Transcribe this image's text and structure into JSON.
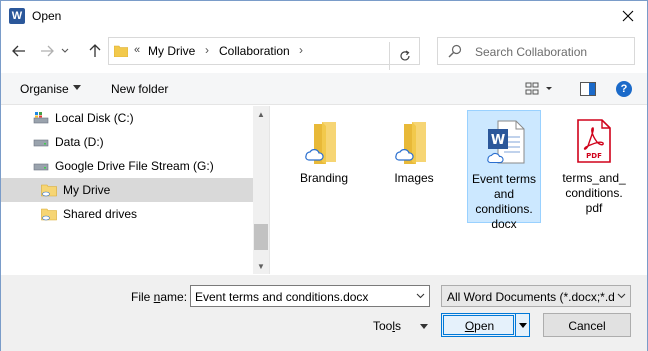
{
  "window": {
    "title": "Open",
    "app_icon_letter": "W",
    "close_glyph": "✕"
  },
  "navbar": {
    "back_glyph": "←",
    "forward_glyph": "→",
    "recent_glyph": "⌄",
    "up_glyph": "↑",
    "overflow_glyph": "«",
    "breadcrumbs": [
      "My Drive",
      "Collaboration"
    ],
    "separator_glyph": "›",
    "refresh_glyph": "↻",
    "search_placeholder": "Search Collaboration"
  },
  "toolbar": {
    "organise_label": "Organise",
    "new_folder_label": "New folder",
    "help_glyph": "?"
  },
  "nav_pane": {
    "items": [
      {
        "label": "Local Disk (C:)",
        "icon": "local-disk-icon",
        "selected": false
      },
      {
        "label": "Data (D:)",
        "icon": "drive-icon",
        "selected": false
      },
      {
        "label": "Google Drive File Stream (G:)",
        "icon": "drive-icon",
        "selected": false
      },
      {
        "label": "My Drive",
        "icon": "folder-icon",
        "selected": true
      },
      {
        "label": "Shared drives",
        "icon": "folder-icon",
        "selected": false
      }
    ]
  },
  "files": [
    {
      "name": "Branding",
      "type": "folder",
      "icon": "cloud-folder-icon",
      "selected": false
    },
    {
      "name": "Images",
      "type": "folder",
      "icon": "cloud-folder-icon",
      "selected": false
    },
    {
      "name": "Event terms and conditions. docx",
      "type": "docx",
      "icon": "word-doc-icon",
      "selected": true
    },
    {
      "name": "terms_and_ conditions. pdf",
      "type": "pdf",
      "icon": "pdf-icon",
      "selected": false
    }
  ],
  "bottom": {
    "file_name_label_prefix": "File ",
    "file_name_label_u": "n",
    "file_name_label_suffix": "ame:",
    "file_name_value": "Event terms and conditions.docx",
    "filter_value": "All Word Documents (*.docx;*.d",
    "tools_prefix": "Too",
    "tools_u": "l",
    "tools_suffix": "s",
    "open_u": "O",
    "open_suffix": "pen",
    "cancel_label": "Cancel"
  },
  "colors": {
    "accent": "#0078d7",
    "word_blue": "#2b579a",
    "pdf_red": "#d0021b",
    "folder_yellow": "#f2c94c",
    "selection_bg": "#cce8ff"
  }
}
